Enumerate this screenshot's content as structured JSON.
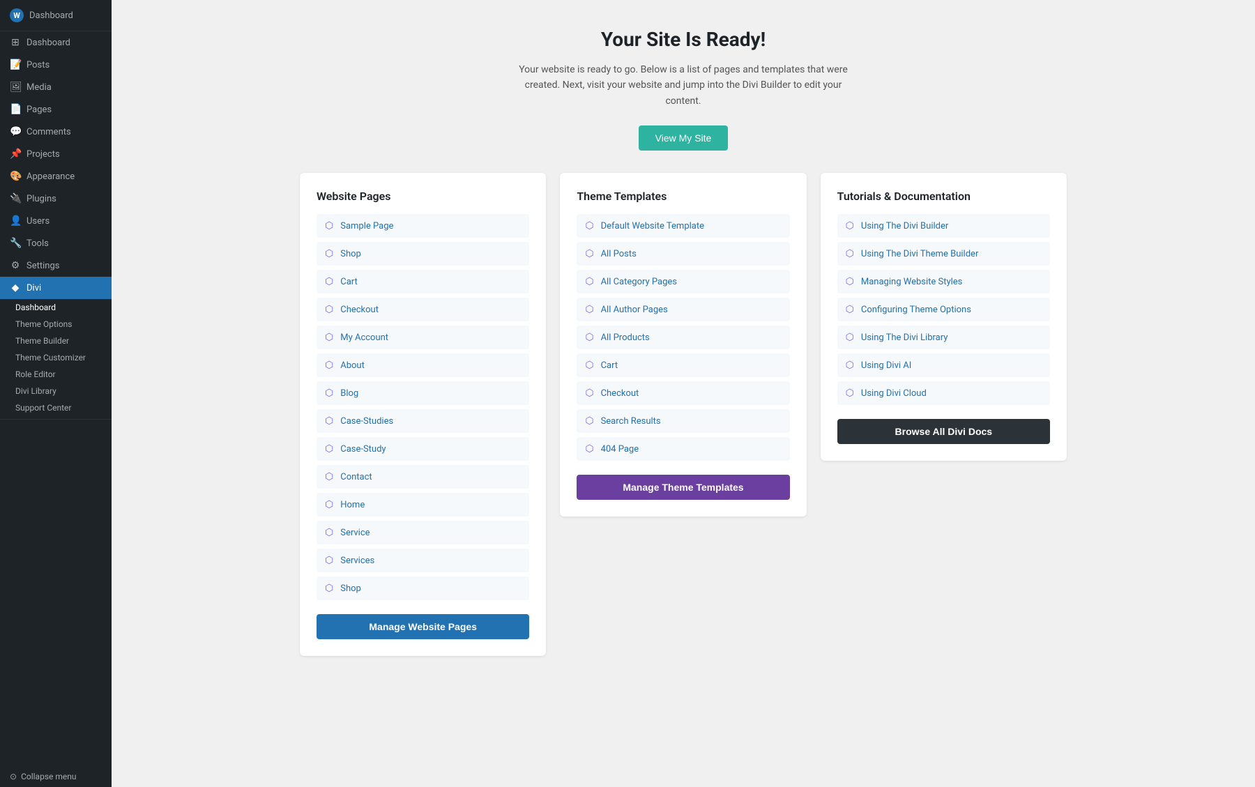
{
  "sidebar": {
    "logo": {
      "icon": "W",
      "label": "Dashboard"
    },
    "items": [
      {
        "id": "dashboard",
        "icon": "⊞",
        "label": "Dashboard",
        "active": false
      },
      {
        "id": "posts",
        "icon": "📝",
        "label": "Posts",
        "active": false
      },
      {
        "id": "media",
        "icon": "🖼",
        "label": "Media",
        "active": false
      },
      {
        "id": "pages",
        "icon": "📄",
        "label": "Pages",
        "active": false
      },
      {
        "id": "comments",
        "icon": "💬",
        "label": "Comments",
        "active": false
      },
      {
        "id": "projects",
        "icon": "📌",
        "label": "Projects",
        "active": false
      },
      {
        "id": "appearance",
        "icon": "🎨",
        "label": "Appearance",
        "active": false
      },
      {
        "id": "plugins",
        "icon": "🔌",
        "label": "Plugins",
        "active": false
      },
      {
        "id": "users",
        "icon": "👤",
        "label": "Users",
        "active": false
      },
      {
        "id": "tools",
        "icon": "🔧",
        "label": "Tools",
        "active": false
      },
      {
        "id": "settings",
        "icon": "⚙",
        "label": "Settings",
        "active": false
      },
      {
        "id": "divi",
        "icon": "◆",
        "label": "Divi",
        "active": true
      }
    ],
    "divi_subitems": [
      {
        "id": "dashboard",
        "label": "Dashboard",
        "active": true
      },
      {
        "id": "theme-options",
        "label": "Theme Options",
        "active": false
      },
      {
        "id": "theme-builder",
        "label": "Theme Builder",
        "active": false
      },
      {
        "id": "theme-customizer",
        "label": "Theme Customizer",
        "active": false
      },
      {
        "id": "role-editor",
        "label": "Role Editor",
        "active": false
      },
      {
        "id": "divi-library",
        "label": "Divi Library",
        "active": false
      },
      {
        "id": "support-center",
        "label": "Support Center",
        "active": false
      }
    ],
    "collapse_label": "Collapse menu"
  },
  "main": {
    "title": "Your Site Is Ready!",
    "subtitle": "Your website is ready to go. Below is a list of pages and templates that were created. Next, visit your website and jump into the Divi Builder to edit your content.",
    "view_site_label": "View My Site",
    "columns": [
      {
        "id": "website-pages",
        "title": "Website Pages",
        "items": [
          "Sample Page",
          "Shop",
          "Cart",
          "Checkout",
          "My Account",
          "About",
          "Blog",
          "Case-Studies",
          "Case-Study",
          "Contact",
          "Home",
          "Service",
          "Services",
          "Shop"
        ],
        "button_label": "Manage Website Pages",
        "button_style": "blue"
      },
      {
        "id": "theme-templates",
        "title": "Theme Templates",
        "items": [
          "Default Website Template",
          "All Posts",
          "All Category Pages",
          "All Author Pages",
          "All Products",
          "Cart",
          "Checkout",
          "Search Results",
          "404 Page"
        ],
        "button_label": "Manage Theme Templates",
        "button_style": "purple"
      },
      {
        "id": "tutorials",
        "title": "Tutorials & Documentation",
        "items": [
          "Using The Divi Builder",
          "Using The Divi Theme Builder",
          "Managing Website Styles",
          "Configuring Theme Options",
          "Using The Divi Library",
          "Using Divi AI",
          "Using Divi Cloud"
        ],
        "button_label": "Browse All Divi Docs",
        "button_style": "dark"
      }
    ]
  }
}
